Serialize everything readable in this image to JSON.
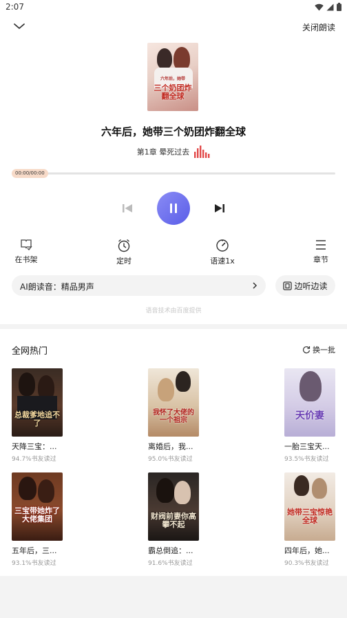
{
  "status": {
    "time": "2:07"
  },
  "header": {
    "close_label": "关闭朗读"
  },
  "book": {
    "title": "六年后，她带三个奶团炸翻全球",
    "chapter": "第1章 晕死过去",
    "cover_text": "三个奶团炸翻全球",
    "cover_small": "六年后，她带"
  },
  "player": {
    "time": "00:00/00:00",
    "progress": 0
  },
  "functions": [
    {
      "label": "在书架",
      "icon": "bookshelf-check-icon"
    },
    {
      "label": "定时",
      "icon": "alarm-clock-icon"
    },
    {
      "label": "语速1x",
      "icon": "speedometer-icon"
    },
    {
      "label": "章节",
      "icon": "list-icon"
    }
  ],
  "voice": {
    "label": "AI朗读音：精品男声"
  },
  "listen": {
    "label": "边听边读"
  },
  "tech_note": "语音技术由百度提供",
  "hot": {
    "title": "全网热门",
    "refresh_label": "换一批",
    "books": [
      {
        "name": "天降三宝：...",
        "rate": "94.7%书友读过",
        "cover_text": "总裁爹地追不了"
      },
      {
        "name": "离婚后，我...",
        "rate": "95.0%书友读过",
        "cover_text": "我怀了大佬的一个祖宗"
      },
      {
        "name": "一胎三宝天...",
        "rate": "93.5%书友读过",
        "cover_text": "天价妻"
      },
      {
        "name": "五年后，三...",
        "rate": "93.1%书友读过",
        "cover_text": "三宝带她炸了大佬集团"
      },
      {
        "name": "霸总倒追：...",
        "rate": "91.6%书友读过",
        "cover_text": "财阀前妻你高攀不起"
      },
      {
        "name": "四年后，她...",
        "rate": "90.3%书友读过",
        "cover_text": "她带三宝惊艳全球"
      }
    ]
  },
  "colors": {
    "accent": "#5a5de8",
    "bars": "#e24848",
    "progress_pill": "#f7dac8"
  }
}
